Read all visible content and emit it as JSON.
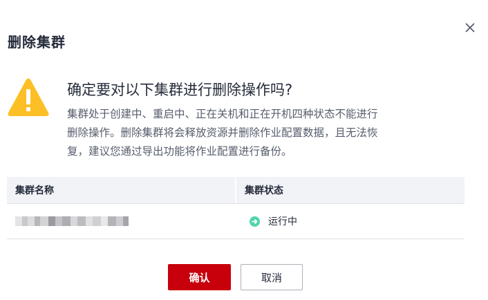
{
  "dialog": {
    "title": "删除集群",
    "close_icon": "close-icon",
    "warning_icon": "warning-triangle-icon",
    "question": "确定要对以下集群进行删除操作吗?",
    "description_lines": [
      "集群处于创建中、重启中、正在关机和正在开机四种状态不能进行",
      "删除操作。删除集群将会释放资源并删除作业配置数据，且无法恢",
      "复，建议您通过导出功能将作业配置进行备份。"
    ]
  },
  "table": {
    "headers": [
      "集群名称",
      "集群状态"
    ],
    "rows": [
      {
        "name": "",
        "status": "运行中",
        "status_icon": "running-arrow-icon"
      }
    ]
  },
  "buttons": {
    "confirm": "确认",
    "cancel": "取消"
  },
  "colors": {
    "primary": "#c7000b",
    "warning": "#fdbf26",
    "status_running": "#50d4ab"
  }
}
